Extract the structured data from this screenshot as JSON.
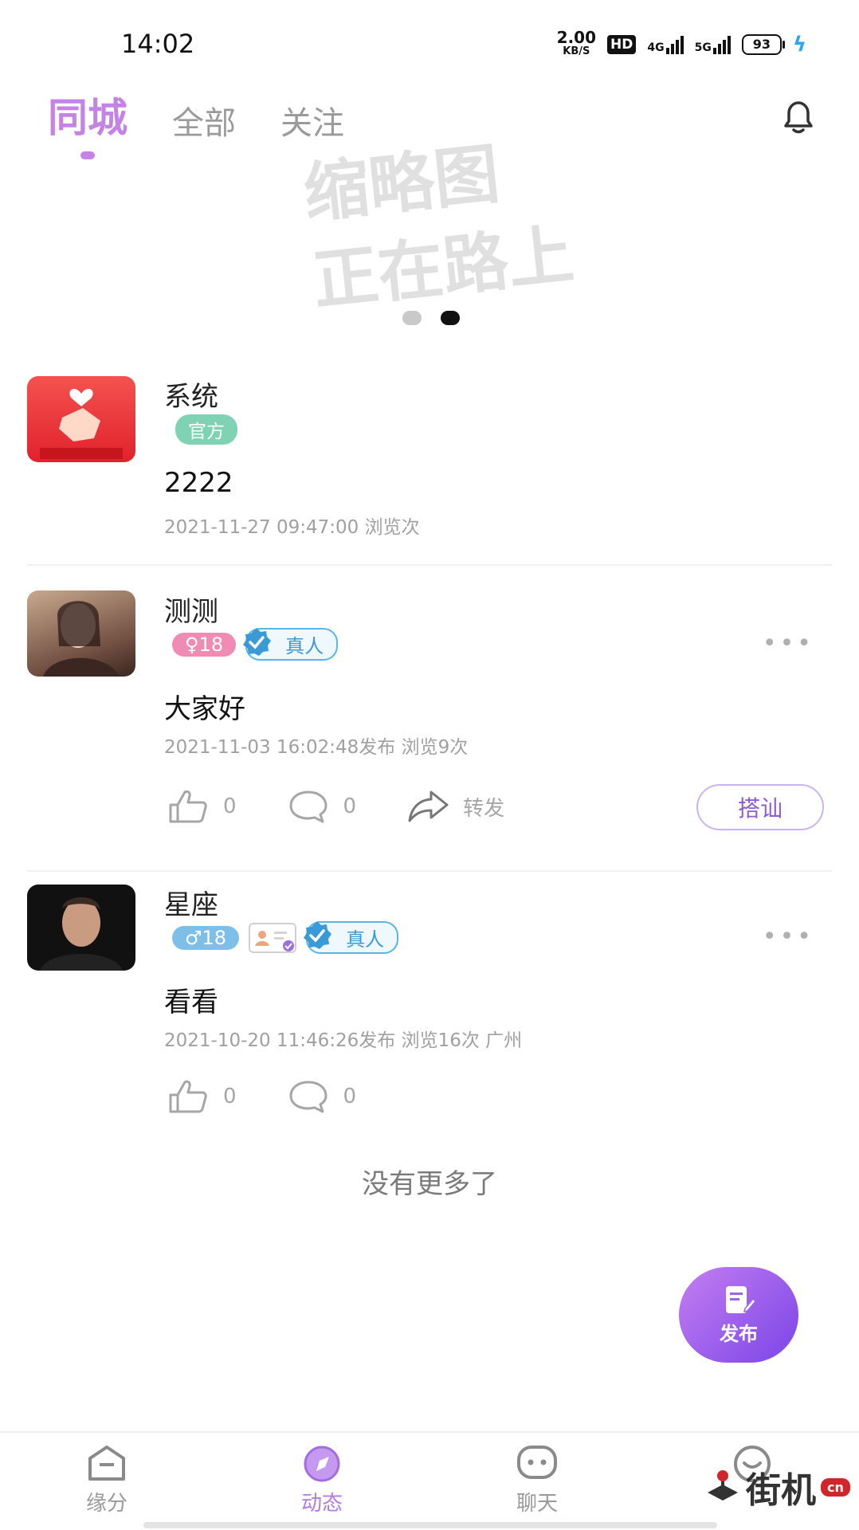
{
  "status_bar": {
    "time": "14:02",
    "net_speed": "2.00",
    "net_unit": "KB/S",
    "hd": "HD",
    "sig1": "4G",
    "sig2": "5G",
    "battery": "93"
  },
  "tabs": [
    {
      "label": "同城",
      "active": true
    },
    {
      "label": "全部",
      "active": false
    },
    {
      "label": "关注",
      "active": false
    }
  ],
  "banner": {
    "line1": "缩略图",
    "line2": "正在路上"
  },
  "posts": [
    {
      "name": "系统",
      "badge": "官方",
      "content": "2222",
      "meta": "2021-11-27 09:47:00 浏览次"
    },
    {
      "name": "测测",
      "age_badge": "♀18",
      "real_badge": "真人",
      "content": "大家好",
      "meta": "2021-11-03 16:02:48发布 浏览9次",
      "likes": "0",
      "comments": "0",
      "share": "转发",
      "chat": "搭讪"
    },
    {
      "name": "星座",
      "age_badge": "♂18",
      "real_badge": "真人",
      "content": "看看",
      "meta": "2021-10-20 11:46:26发布 浏览16次 广州",
      "likes": "0",
      "comments": "0"
    }
  ],
  "no_more": "没有更多了",
  "fab": {
    "label": "发布"
  },
  "bottom_nav": [
    {
      "label": "缘分"
    },
    {
      "label": "动态"
    },
    {
      "label": "聊天"
    }
  ],
  "watermark": {
    "text": "街机",
    "suffix": "cn"
  }
}
